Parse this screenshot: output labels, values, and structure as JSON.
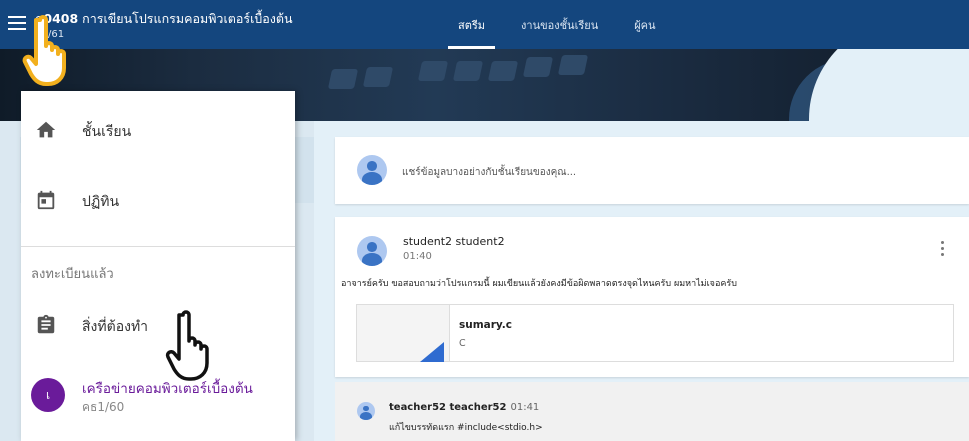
{
  "header": {
    "class_code_bold": "0408",
    "class_title_prefix": "ค",
    "class_title_suffix": "การเขียนโปรแกรมคอมพิวเตอร์เบื้องต้น",
    "class_section": "ค1/61",
    "tabs": [
      {
        "label": "สตรีม",
        "active": true
      },
      {
        "label": "งานของชั้นเรียน",
        "active": false
      },
      {
        "label": "ผู้คน",
        "active": false
      }
    ]
  },
  "drawer": {
    "items": [
      {
        "label": "ชั้นเรียน",
        "icon": "home-icon"
      },
      {
        "label": "ปฏิทิน",
        "icon": "calendar-icon"
      }
    ],
    "section_label": "ลงทะเบียนแล้ว",
    "todo_label": "สิ่งที่ต้องทำ",
    "enrolled_class": {
      "avatar_letter": "เ",
      "name": "เครือข่ายคอมพิวเตอร์เบื้องต้น",
      "code": "คธ1/60",
      "color": "#6a1b9a"
    }
  },
  "stream": {
    "share_placeholder": "แชร์ข้อมูลบางอย่างกับชั้นเรียนของคุณ...",
    "post": {
      "author": "student2 student2",
      "time": "01:40",
      "body": "อาจารย์ครับ ขอสอบถามว่าโปรแกรมนี้ ผมเขียนแล้วยังคงมีข้อผิดพลาดตรงจุดไหนครับ ผมหาไม่เจอครับ",
      "attachment": {
        "name": "sumary.c",
        "type": "C"
      }
    },
    "comment": {
      "author": "teacher52 teacher52",
      "time": "01:41",
      "text": "แก้ไขบรรทัดแรก #include<stdio.h>"
    }
  },
  "colors": {
    "header_bg": "#14467e",
    "page_bg": "#e3f0f8",
    "accent_purple": "#6a1b9a",
    "avatar_blue": "#3a73c4"
  }
}
